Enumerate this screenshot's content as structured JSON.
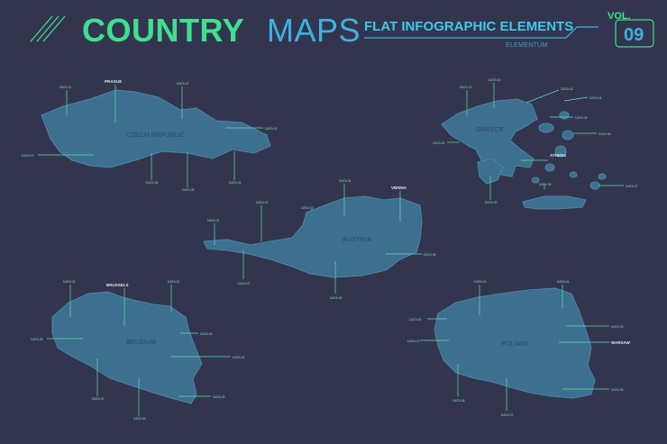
{
  "header": {
    "title_main": "COUNTRY",
    "title_accent": "MAPS",
    "subtitle": "FLAT INFOGRAPHIC ELEMENTS",
    "brand": "ELEMENTUM",
    "vol_label": "VOL.",
    "vol_number": "09"
  },
  "colors": {
    "background": "#33354f",
    "accent_green": "#3ee08f",
    "accent_blue": "#3fb1e0",
    "map_fill": "#3d6f8e"
  },
  "maps": {
    "czech": {
      "name": "CZECH REPUBLIC",
      "city": "PRAGUE",
      "labels": [
        "DATA 01",
        "DATA 02",
        "DATA 03",
        "DATA 04",
        "DATA 05",
        "DATA 06",
        "DATA 07"
      ]
    },
    "greece": {
      "name": "GREECE",
      "city": "ATHENS",
      "labels": [
        "DATA 01",
        "DATA 02",
        "DATA 03",
        "DATA 04",
        "DATA 05",
        "DATA 06",
        "DATA 07",
        "DATA 08",
        "DATA 09"
      ]
    },
    "austria": {
      "name": "AUSTRIA",
      "city": "VIENNA",
      "labels": [
        "DATA 01",
        "DATA 02",
        "DATA 03",
        "DATA 04",
        "DATA 05",
        "DATA 06",
        "DATA 07"
      ]
    },
    "belgium": {
      "name": "BELGIUM",
      "city": "BRUSSELS",
      "labels": [
        "DATA 01",
        "DATA 02",
        "DATA 03",
        "DATA 04",
        "DATA 05",
        "DATA 06",
        "DATA 07",
        "DATA 08"
      ]
    },
    "poland": {
      "name": "POLAND",
      "city": "WARSAW",
      "labels": [
        "DATA 01",
        "DATA 02",
        "DATA 03",
        "DATA 04",
        "DATA 05",
        "DATA 06",
        "DATA 07",
        "DATA 08"
      ]
    }
  }
}
